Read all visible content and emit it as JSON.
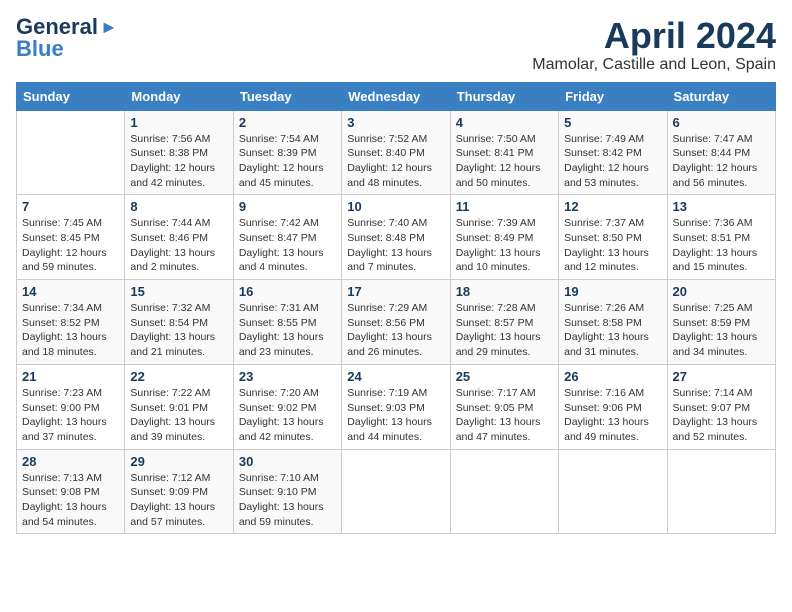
{
  "header": {
    "logo_general": "General",
    "logo_blue": "Blue",
    "month_year": "April 2024",
    "location": "Mamolar, Castille and Leon, Spain"
  },
  "days_of_week": [
    "Sunday",
    "Monday",
    "Tuesday",
    "Wednesday",
    "Thursday",
    "Friday",
    "Saturday"
  ],
  "weeks": [
    [
      {
        "day": "",
        "info": ""
      },
      {
        "day": "1",
        "info": "Sunrise: 7:56 AM\nSunset: 8:38 PM\nDaylight: 12 hours\nand 42 minutes."
      },
      {
        "day": "2",
        "info": "Sunrise: 7:54 AM\nSunset: 8:39 PM\nDaylight: 12 hours\nand 45 minutes."
      },
      {
        "day": "3",
        "info": "Sunrise: 7:52 AM\nSunset: 8:40 PM\nDaylight: 12 hours\nand 48 minutes."
      },
      {
        "day": "4",
        "info": "Sunrise: 7:50 AM\nSunset: 8:41 PM\nDaylight: 12 hours\nand 50 minutes."
      },
      {
        "day": "5",
        "info": "Sunrise: 7:49 AM\nSunset: 8:42 PM\nDaylight: 12 hours\nand 53 minutes."
      },
      {
        "day": "6",
        "info": "Sunrise: 7:47 AM\nSunset: 8:44 PM\nDaylight: 12 hours\nand 56 minutes."
      }
    ],
    [
      {
        "day": "7",
        "info": "Sunrise: 7:45 AM\nSunset: 8:45 PM\nDaylight: 12 hours\nand 59 minutes."
      },
      {
        "day": "8",
        "info": "Sunrise: 7:44 AM\nSunset: 8:46 PM\nDaylight: 13 hours\nand 2 minutes."
      },
      {
        "day": "9",
        "info": "Sunrise: 7:42 AM\nSunset: 8:47 PM\nDaylight: 13 hours\nand 4 minutes."
      },
      {
        "day": "10",
        "info": "Sunrise: 7:40 AM\nSunset: 8:48 PM\nDaylight: 13 hours\nand 7 minutes."
      },
      {
        "day": "11",
        "info": "Sunrise: 7:39 AM\nSunset: 8:49 PM\nDaylight: 13 hours\nand 10 minutes."
      },
      {
        "day": "12",
        "info": "Sunrise: 7:37 AM\nSunset: 8:50 PM\nDaylight: 13 hours\nand 12 minutes."
      },
      {
        "day": "13",
        "info": "Sunrise: 7:36 AM\nSunset: 8:51 PM\nDaylight: 13 hours\nand 15 minutes."
      }
    ],
    [
      {
        "day": "14",
        "info": "Sunrise: 7:34 AM\nSunset: 8:52 PM\nDaylight: 13 hours\nand 18 minutes."
      },
      {
        "day": "15",
        "info": "Sunrise: 7:32 AM\nSunset: 8:54 PM\nDaylight: 13 hours\nand 21 minutes."
      },
      {
        "day": "16",
        "info": "Sunrise: 7:31 AM\nSunset: 8:55 PM\nDaylight: 13 hours\nand 23 minutes."
      },
      {
        "day": "17",
        "info": "Sunrise: 7:29 AM\nSunset: 8:56 PM\nDaylight: 13 hours\nand 26 minutes."
      },
      {
        "day": "18",
        "info": "Sunrise: 7:28 AM\nSunset: 8:57 PM\nDaylight: 13 hours\nand 29 minutes."
      },
      {
        "day": "19",
        "info": "Sunrise: 7:26 AM\nSunset: 8:58 PM\nDaylight: 13 hours\nand 31 minutes."
      },
      {
        "day": "20",
        "info": "Sunrise: 7:25 AM\nSunset: 8:59 PM\nDaylight: 13 hours\nand 34 minutes."
      }
    ],
    [
      {
        "day": "21",
        "info": "Sunrise: 7:23 AM\nSunset: 9:00 PM\nDaylight: 13 hours\nand 37 minutes."
      },
      {
        "day": "22",
        "info": "Sunrise: 7:22 AM\nSunset: 9:01 PM\nDaylight: 13 hours\nand 39 minutes."
      },
      {
        "day": "23",
        "info": "Sunrise: 7:20 AM\nSunset: 9:02 PM\nDaylight: 13 hours\nand 42 minutes."
      },
      {
        "day": "24",
        "info": "Sunrise: 7:19 AM\nSunset: 9:03 PM\nDaylight: 13 hours\nand 44 minutes."
      },
      {
        "day": "25",
        "info": "Sunrise: 7:17 AM\nSunset: 9:05 PM\nDaylight: 13 hours\nand 47 minutes."
      },
      {
        "day": "26",
        "info": "Sunrise: 7:16 AM\nSunset: 9:06 PM\nDaylight: 13 hours\nand 49 minutes."
      },
      {
        "day": "27",
        "info": "Sunrise: 7:14 AM\nSunset: 9:07 PM\nDaylight: 13 hours\nand 52 minutes."
      }
    ],
    [
      {
        "day": "28",
        "info": "Sunrise: 7:13 AM\nSunset: 9:08 PM\nDaylight: 13 hours\nand 54 minutes."
      },
      {
        "day": "29",
        "info": "Sunrise: 7:12 AM\nSunset: 9:09 PM\nDaylight: 13 hours\nand 57 minutes."
      },
      {
        "day": "30",
        "info": "Sunrise: 7:10 AM\nSunset: 9:10 PM\nDaylight: 13 hours\nand 59 minutes."
      },
      {
        "day": "",
        "info": ""
      },
      {
        "day": "",
        "info": ""
      },
      {
        "day": "",
        "info": ""
      },
      {
        "day": "",
        "info": ""
      }
    ]
  ]
}
